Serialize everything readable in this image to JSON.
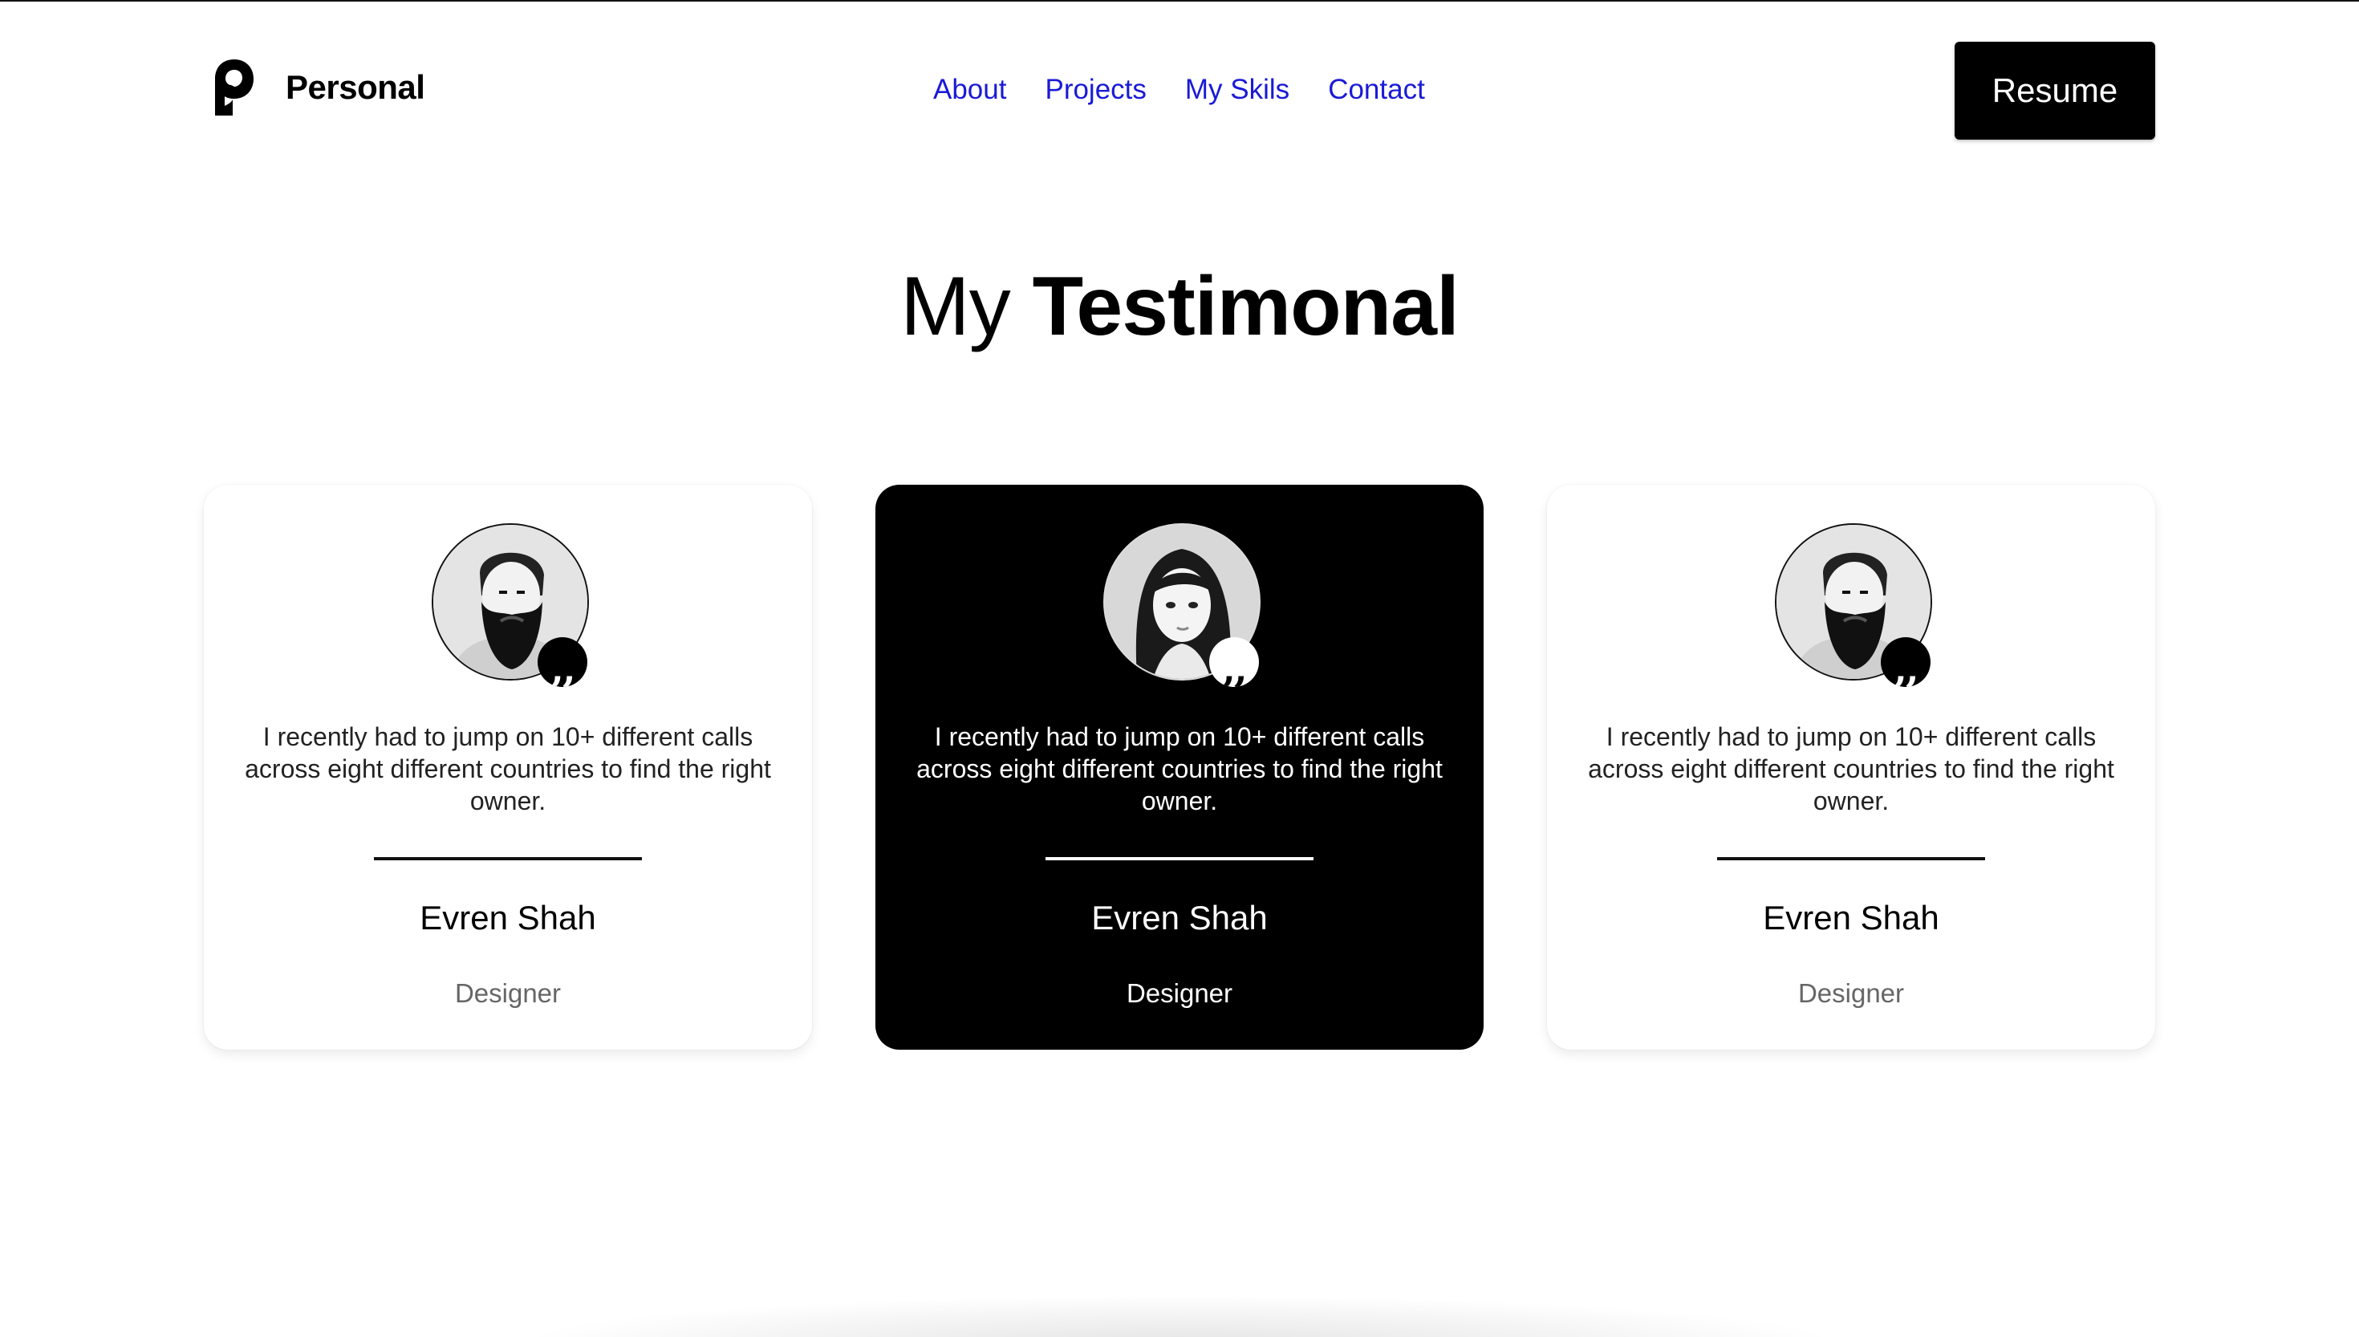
{
  "brand": {
    "name": "Personal",
    "logo_icon": "p-logo-icon"
  },
  "nav": {
    "items": [
      {
        "label": "About"
      },
      {
        "label": "Projects"
      },
      {
        "label": "My Skils"
      },
      {
        "label": "Contact"
      }
    ],
    "link_color": "#1a1ad6"
  },
  "header": {
    "resume_label": "Resume"
  },
  "section": {
    "title_regular": "My",
    "title_bold": "Testimonal"
  },
  "testimonials": [
    {
      "quote": "I recently had to jump on 10+ different calls across eight different countries to find the right owner.",
      "name": "Evren Shah",
      "role": "Designer",
      "avatar": "bearded-man-avatar",
      "quote_icon": "quote-icon",
      "theme": "light"
    },
    {
      "quote": "I recently had to jump on 10+ different calls across eight different countries to find the right owner.",
      "name": "Evren Shah",
      "role": "Designer",
      "avatar": "woman-avatar",
      "quote_icon": "quote-icon",
      "theme": "dark"
    },
    {
      "quote": "I recently had to jump on 10+ different calls across eight different countries to find the right owner.",
      "name": "Evren Shah",
      "role": "Designer",
      "avatar": "bearded-man-avatar",
      "quote_icon": "quote-icon",
      "theme": "light"
    }
  ],
  "colors": {
    "background": "#ffffff",
    "primary": "#000000",
    "muted_text": "#666666"
  }
}
